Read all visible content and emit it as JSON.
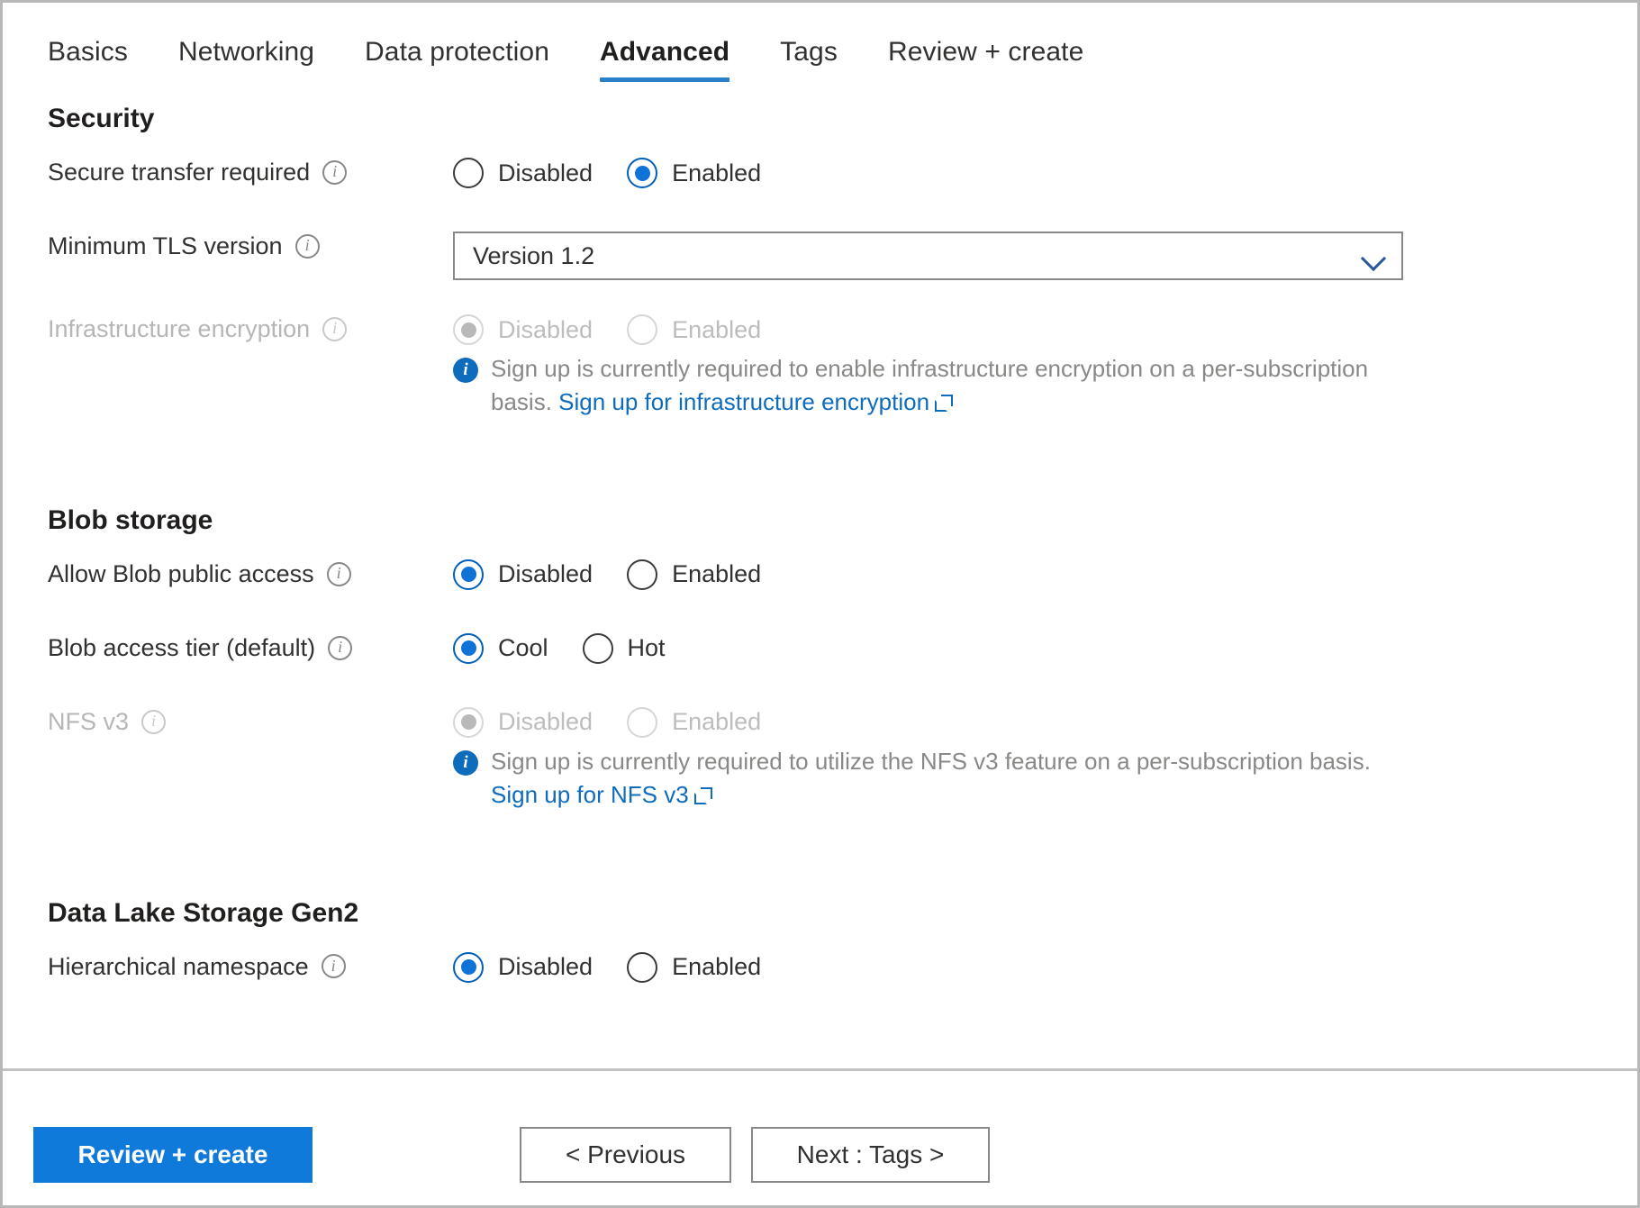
{
  "tabs": [
    {
      "label": "Basics",
      "active": false
    },
    {
      "label": "Networking",
      "active": false
    },
    {
      "label": "Data protection",
      "active": false
    },
    {
      "label": "Advanced",
      "active": true
    },
    {
      "label": "Tags",
      "active": false
    },
    {
      "label": "Review + create",
      "active": false
    }
  ],
  "colors": {
    "accent": "#0f7ada",
    "tab_underline": "#2a7fc9",
    "link": "#0f6cbd",
    "radio_selected": "#0f72d6",
    "disabled_text": "#bdbdbd"
  },
  "sections": {
    "security": {
      "title": "Security",
      "secure_transfer": {
        "label": "Secure transfer required",
        "options": [
          "Disabled",
          "Enabled"
        ],
        "selected": "Enabled"
      },
      "min_tls": {
        "label": "Minimum TLS version",
        "value": "Version 1.2"
      },
      "infrastructure_encryption": {
        "label": "Infrastructure encryption",
        "options": [
          "Disabled",
          "Enabled"
        ],
        "selected": "Disabled",
        "disabled": true,
        "info_text": "Sign up is currently required to enable infrastructure encryption on a per-subscription basis.",
        "info_link": "Sign up for infrastructure encryption"
      }
    },
    "blob_storage": {
      "title": "Blob storage",
      "public_access": {
        "label": "Allow Blob public access",
        "options": [
          "Disabled",
          "Enabled"
        ],
        "selected": "Disabled"
      },
      "access_tier": {
        "label": "Blob access tier (default)",
        "options": [
          "Cool",
          "Hot"
        ],
        "selected": "Cool"
      },
      "nfs_v3": {
        "label": "NFS v3",
        "options": [
          "Disabled",
          "Enabled"
        ],
        "selected": "Disabled",
        "disabled": true,
        "info_text": "Sign up is currently required to utilize the NFS v3 feature on a per-subscription basis.",
        "info_link": "Sign up for NFS v3"
      }
    },
    "data_lake": {
      "title": "Data Lake Storage Gen2",
      "hierarchical_namespace": {
        "label": "Hierarchical namespace",
        "options": [
          "Disabled",
          "Enabled"
        ],
        "selected": "Disabled"
      }
    }
  },
  "footer": {
    "review_create": "Review + create",
    "previous": "< Previous",
    "next": "Next : Tags >"
  }
}
